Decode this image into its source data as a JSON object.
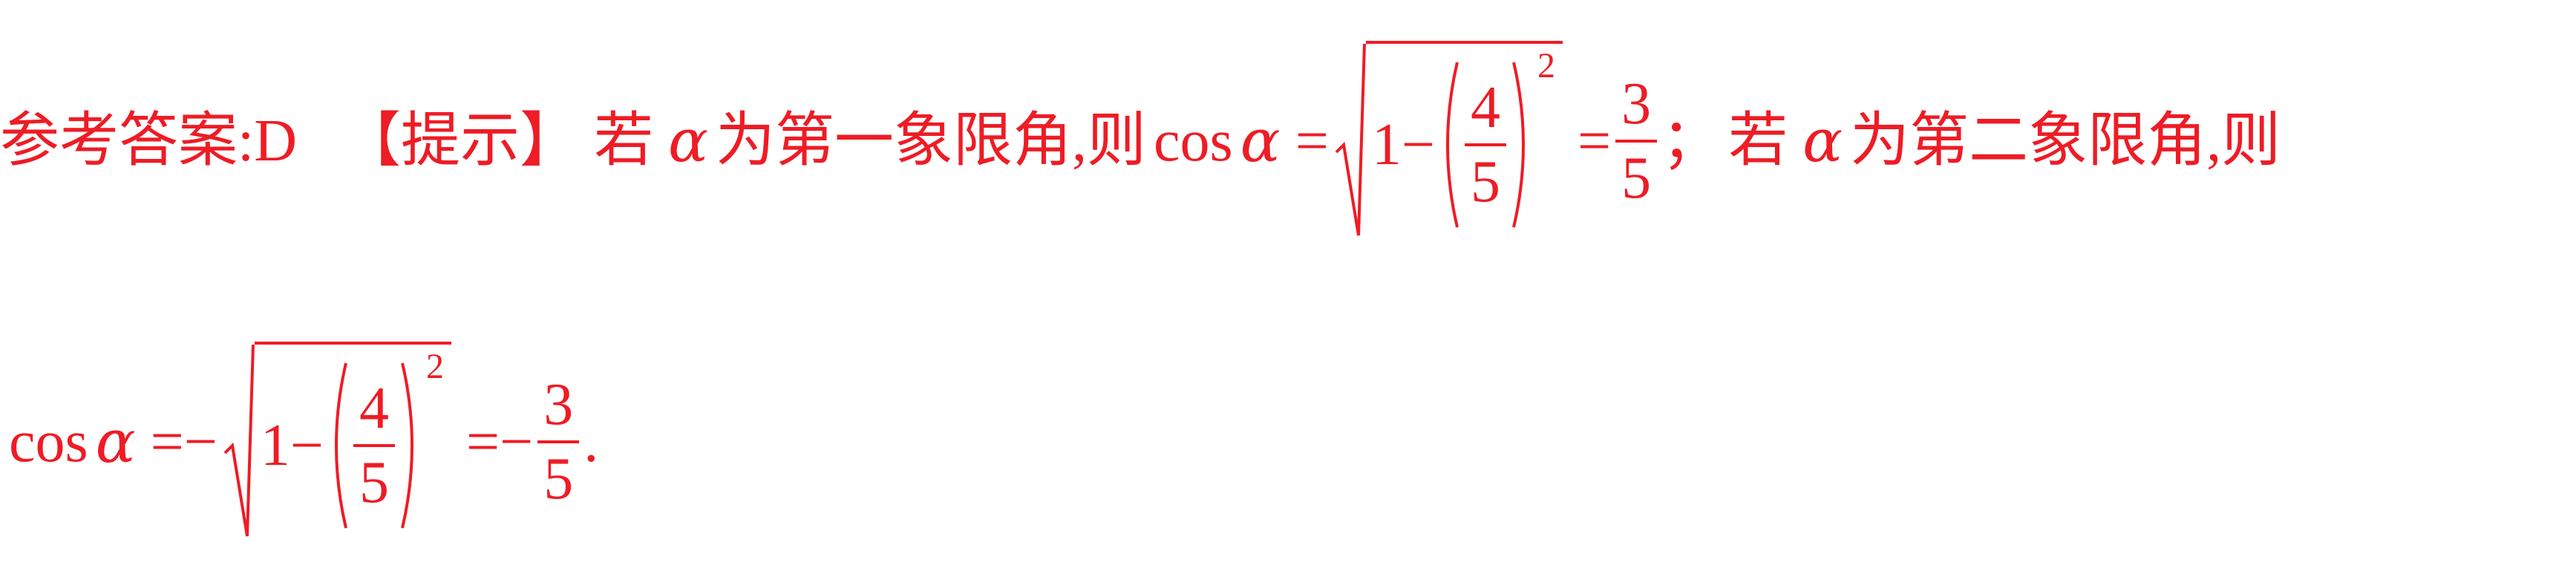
{
  "line1": {
    "answer_label": "参考答案:D",
    "hint_label": "【提示】",
    "case1_prefix": "若",
    "alpha": "α",
    "case1_text": "为第一象限角,则",
    "cos": "cos",
    "eq": "=",
    "one": "1",
    "minus": "−",
    "frac_num": "4",
    "frac_den": "5",
    "exponent": "2",
    "result_num": "3",
    "result_den": "5",
    "semicolon": "；",
    "case2_prefix": "若",
    "case2_text": "为第二象限角,则"
  },
  "line2": {
    "cos": "cos",
    "alpha": "α",
    "eq_neg": "=−",
    "one": "1",
    "minus": "−",
    "frac_num": "4",
    "frac_den": "5",
    "exponent": "2",
    "eq_neg2": "=−",
    "result_num": "3",
    "result_den": "5",
    "period": "."
  },
  "colors": {
    "text": "#ee1c25",
    "background": "#ffffff"
  }
}
